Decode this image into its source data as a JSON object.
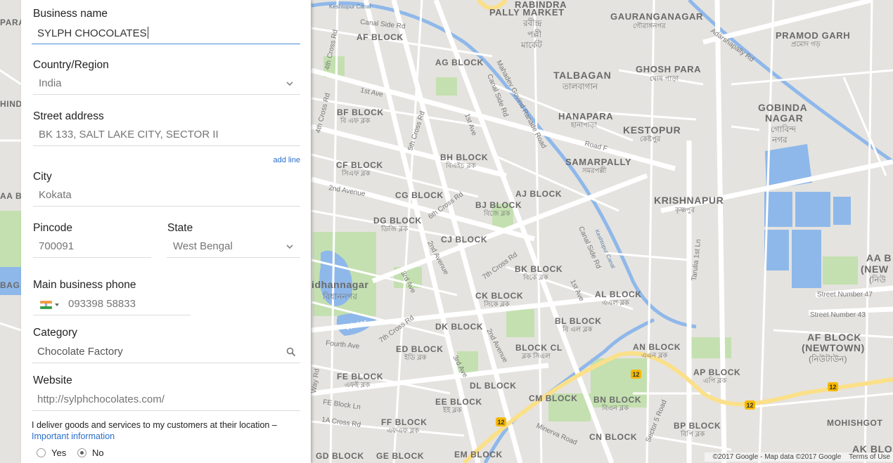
{
  "form": {
    "business_name": {
      "label": "Business name",
      "value": "SYLPH CHOCOLATES"
    },
    "country": {
      "label": "Country/Region",
      "value": "India"
    },
    "street": {
      "label": "Street address",
      "value": "BK 133, SALT LAKE CITY, SECTOR II",
      "add_line": "add line"
    },
    "city": {
      "label": "City",
      "value": "Kokata"
    },
    "pincode": {
      "label": "Pincode",
      "value": "700091"
    },
    "state": {
      "label": "State",
      "value": "West Bengal"
    },
    "phone": {
      "label": "Main business phone",
      "value": "093398 58833"
    },
    "category": {
      "label": "Category",
      "value": "Chocolate Factory"
    },
    "website": {
      "label": "Website",
      "value": "http://sylphchocolates.com/"
    },
    "delivery": {
      "question": "I deliver goods and services to my customers at their location –",
      "link": "Important information",
      "options": [
        "Yes",
        "No"
      ],
      "selected": "No"
    }
  },
  "map": {
    "labels": {
      "rabindra": "RABINDRA",
      "pally_market": "PALLY MARKET",
      "rabindra_bn1": "রবীন্দ্র",
      "rabindra_bn2": "পল্লী",
      "rabindra_bn3": "মার্কেট",
      "gauranganagar": "GAURANGANAGAR",
      "gauranganagar_bn": "গৌরাঙ্গনগর",
      "pramod_garh": "PRAMOD GARH",
      "pramod_garh_bn": "প্রমোদ গড়",
      "talbagan": "TALBAGAN",
      "talbagan_bn": "তালবাগান",
      "ghosh_para": "GHOSH PARA",
      "ghosh_para_bn": "ঘোষ পাড়া",
      "gobinda": "GOBINDA",
      "nagar": "NAGAR",
      "gobinda_bn1": "গোবিন্দ",
      "gobinda_bn2": "নগর",
      "hanapara": "HANAPARA",
      "hanapara_bn": "হানাপাড়া",
      "kestopur": "KESTOPUR",
      "kestopur_bn": "কেষ্টপুর",
      "samarpally": "SAMARPALLY",
      "samarpally_bn": "সমরপল্লী",
      "krishnapur": "KRISHNAPUR",
      "krishnapur_bn": "কৃষ্ণপুর",
      "af_block": "AF BLOCK",
      "ag_block": "AG BLOCK",
      "bf_block": "BF BLOCK",
      "bf_block_bn": "বি এফ ব্লক",
      "bh_block": "BH BLOCK",
      "bh_block_bn": "বিএইচ ব্লক",
      "cf_block": "CF BLOCK",
      "cf_block_bn": "সিএফ ব্লক",
      "cg_block": "CG BLOCK",
      "aj_block": "AJ BLOCK",
      "bj_block": "BJ BLOCK",
      "bj_block_bn": "বিজে ব্লক",
      "dg_block": "DG BLOCK",
      "dg_block_bn": "ডিজি ব্লক",
      "cj_block": "CJ BLOCK",
      "bk_block": "BK BLOCK",
      "bk_block_bn": "বিকে ব্লক",
      "ck_block": "CK BLOCK",
      "ck_block_bn": "সিকে ব্লক",
      "al_block": "AL BLOCK",
      "al_block_bn": "এএল ব্লক",
      "bl_block": "BL BLOCK",
      "bl_block_bn": "বি এল ব্লক",
      "dk_block": "DK BLOCK",
      "ed_block": "ED BLOCK",
      "ed_block_bn": "ইডি ব্লক",
      "block_cl": "BLOCK CL",
      "block_cl_bn": "ব্লক সিএল",
      "an_block": "AN BLOCK",
      "an_block_bn": "এএন ব্লক",
      "fe_block": "FE BLOCK",
      "fe_block_bn": "এফই ব্লক",
      "dl_block": "DL BLOCK",
      "ap_block": "AP BLOCK",
      "ap_block_bn": "এপি ব্লক",
      "af_block_newtown": "AF BLOCK",
      "newtown": "(NEWTOWN)",
      "newtown_bn": "(নিউটাউন)",
      "aa_b": "AA B",
      "new": "(NEW",
      "new_bn": "(নিউ",
      "ee_block": "EE BLOCK",
      "ee_block_bn": "ইই ব্লক",
      "cm_block": "CM BLOCK",
      "bn_block": "BN BLOCK",
      "bn_block_bn": "বিএন ব্লক",
      "ff_block": "FF BLOCK",
      "ff_block_bn": "এফএফ ব্লক",
      "bp_block": "BP BLOCK",
      "bp_block_bn": "বিপি ব্লক",
      "cn_block": "CN BLOCK",
      "mohishgot": "MOHISHGOT",
      "ak_blo": "AK BLO",
      "gd_block": "GD BLOCK",
      "ge_block": "GE BLOCK",
      "em_block": "EM BLOCK",
      "bidhannagar": "idhannagar",
      "bidhannagar_bn": "বিধাননগর",
      "water": "Water",
      "para": "PARA",
      "hind": "HIND",
      "aa_b_left": "AA B",
      "bag": "BAG"
    },
    "roads": {
      "keshtopur_canal": "Keshtopur Canal",
      "canal_side_rd": "Canal Side Rd",
      "fourth_cross": "4th Cross Rd",
      "first_ave": "1st Ave",
      "mahadev": "Mahadev Govind Ranade Road",
      "canal_side_rd2": "Canal Side Rd",
      "first_ave2": "1st Ave",
      "fifth_cross": "5th Cross Rd",
      "second_ave": "2nd Avenue",
      "sixth_cross": "6th Cross Rd",
      "second_ave2": "2nd Avenue",
      "seventh_cross": "7th Cross Rd",
      "third_ave": "3rd Ave",
      "fourth_ave": "Fourth Ave",
      "seventh_cross2": "7th Cross Rd",
      "third_ave2": "3rd Ave",
      "second_ave3": "2nd Avenue",
      "fe_block_ln": "FE Block Ln",
      "onea_cross": "1A Cross Rd",
      "minerva": "Minerva Road",
      "sector5": "Sector 5 Road",
      "road_f": "Road F",
      "canal_side_rd3": "Canal Side Rd",
      "keshtopur_canal2": "Keshtopur Canal",
      "first_ave3": "1st Ave",
      "tarulia": "Tarulia 1st Ln",
      "street47": "Street Number 47",
      "street43": "Street Number 43",
      "adarshapally": "Adarshapally Rd",
      "way_rd": "Way Rd",
      "shield12": "12"
    },
    "attribution": {
      "copyright": "©2017 Google - Map data ©2017 Google",
      "terms": "Terms of Use"
    }
  },
  "colors": {
    "map_bg": "#e5e3df",
    "road": "#ffffff",
    "water": "#8fb8ea",
    "park": "#c4e0b0",
    "highway": "#fbe08a",
    "link": "#2a6fc9",
    "focus": "#4a8fd8"
  }
}
